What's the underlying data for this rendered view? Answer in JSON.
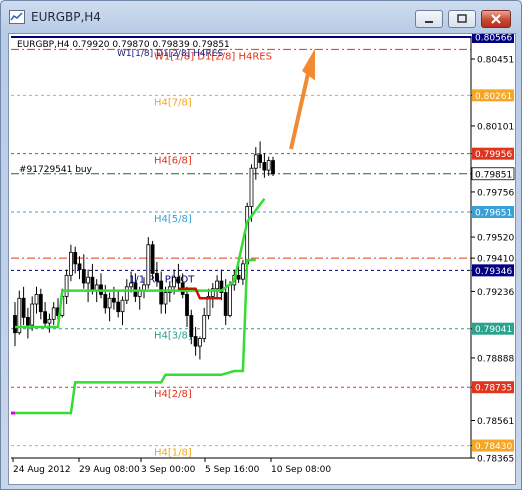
{
  "window": {
    "title": "EURGBP,H4",
    "app_icon": "chart-window-icon",
    "controls": [
      "minimize-icon",
      "maximize-icon",
      "close-icon"
    ]
  },
  "header_text": "EURGBP,H4  0.79920 0.79870 0.79839 0.79851",
  "overlap_label": "W1[1/8] D1[2/8] H4RES",
  "order_label": "#91729541 buy",
  "pivot_label": "1/1 R1 PIVOT",
  "colors": {
    "candle": "#000000",
    "trend_line": "#33dd33",
    "arrow": "#f28a33",
    "red_level": "#e0341c",
    "orange_level": "#f5a623",
    "blue_level": "#3aa0d8",
    "navy_level": "#000080",
    "green_dashdot": "#1e6e1e",
    "teal_level": "#2aa28c"
  },
  "chart_data": {
    "type": "candlestick",
    "ylim": [
      0.78365,
      0.80566
    ],
    "y_ticks": [
      "0.80566",
      "0.80451",
      "0.80261",
      "0.80101",
      "0.79956",
      "0.79851",
      "0.79756",
      "0.79651",
      "0.79520",
      "0.79410",
      "0.79346",
      "0.79236",
      "0.79041",
      "0.78888",
      "0.78735",
      "0.78561",
      "0.78430",
      "0.78365"
    ],
    "x_ticks": [
      "24 Aug 2012",
      "29 Aug 08:00",
      "3 Sep 00:00",
      "5 Sep 16:00",
      "10 Sep 08:00"
    ],
    "levels": [
      {
        "label": "",
        "value": 0.80566,
        "color": "#000080",
        "style": "solid",
        "tag": "0.80566"
      },
      {
        "label": "W1[1/8] D1[2/8] H4RES",
        "value": 0.80501,
        "color": "#e0341c",
        "style": "dashdot",
        "tag": ""
      },
      {
        "label": "H4[7/8]",
        "value": 0.80261,
        "color": "#f5a623",
        "style": "dashed",
        "tag": "0.80261"
      },
      {
        "label": "H4[6/8]",
        "value": 0.79956,
        "color": "#e0341c",
        "style": "dashed",
        "tag": "0.79956"
      },
      {
        "label": "#91729541 buy",
        "value": 0.79851,
        "color": "#1e6e1e",
        "style": "dashdot",
        "tag": "0.79851"
      },
      {
        "label": "H4[5/8]",
        "value": 0.79651,
        "color": "#3aa0d8",
        "style": "dashed",
        "tag": "0.79651"
      },
      {
        "label": "",
        "value": 0.7941,
        "color": "#e0341c",
        "style": "dashdot",
        "tag": ""
      },
      {
        "label": "",
        "value": 0.79346,
        "color": "#000080",
        "style": "dashed",
        "tag": "0.79346"
      },
      {
        "label": "H4[3/8]",
        "value": 0.79041,
        "color": "#2aa28c",
        "style": "dashed",
        "tag": "0.79041"
      },
      {
        "label": "H4[2/8]",
        "value": 0.78735,
        "color": "#e0341c",
        "style": "dashed",
        "tag": "0.78735"
      },
      {
        "label": "H4[1/8]",
        "value": 0.7843,
        "color": "#f5a623",
        "style": "dashed",
        "tag": "0.78430"
      }
    ],
    "candles": [
      [
        0.7911,
        0.7918,
        0.7895,
        0.7902
      ],
      [
        0.7902,
        0.7924,
        0.7901,
        0.792
      ],
      [
        0.792,
        0.7926,
        0.7906,
        0.791
      ],
      [
        0.791,
        0.7915,
        0.7899,
        0.7906
      ],
      [
        0.7906,
        0.7921,
        0.7903,
        0.7917
      ],
      [
        0.7917,
        0.7926,
        0.7912,
        0.7922
      ],
      [
        0.7922,
        0.7925,
        0.7909,
        0.7913
      ],
      [
        0.7913,
        0.7918,
        0.7905,
        0.7907
      ],
      [
        0.7907,
        0.7912,
        0.7902,
        0.7909
      ],
      [
        0.7909,
        0.7918,
        0.7906,
        0.7915
      ],
      [
        0.7915,
        0.792,
        0.7908,
        0.7911
      ],
      [
        0.7911,
        0.7925,
        0.791,
        0.7921
      ],
      [
        0.7921,
        0.7935,
        0.7917,
        0.7932
      ],
      [
        0.7932,
        0.7948,
        0.7929,
        0.7944
      ],
      [
        0.7944,
        0.7947,
        0.7933,
        0.7938
      ],
      [
        0.7938,
        0.7942,
        0.793,
        0.7935
      ],
      [
        0.7935,
        0.7943,
        0.7925,
        0.7928
      ],
      [
        0.7928,
        0.7935,
        0.7918,
        0.7931
      ],
      [
        0.7931,
        0.7938,
        0.7922,
        0.7924
      ],
      [
        0.7924,
        0.793,
        0.7918,
        0.7927
      ],
      [
        0.7927,
        0.7933,
        0.792,
        0.7922
      ],
      [
        0.7922,
        0.7927,
        0.7912,
        0.7915
      ],
      [
        0.7915,
        0.7923,
        0.7908,
        0.792
      ],
      [
        0.792,
        0.7926,
        0.7914,
        0.7918
      ],
      [
        0.7918,
        0.7924,
        0.791,
        0.7913
      ],
      [
        0.7913,
        0.7921,
        0.7906,
        0.7919
      ],
      [
        0.7919,
        0.793,
        0.7917,
        0.7926
      ],
      [
        0.7926,
        0.7934,
        0.7923,
        0.7928
      ],
      [
        0.7928,
        0.7933,
        0.7918,
        0.7921
      ],
      [
        0.7921,
        0.7926,
        0.7914,
        0.7924
      ],
      [
        0.7924,
        0.7931,
        0.792,
        0.7927
      ],
      [
        0.7927,
        0.7952,
        0.7925,
        0.7948
      ],
      [
        0.7948,
        0.795,
        0.793,
        0.7933
      ],
      [
        0.7933,
        0.7939,
        0.7926,
        0.7929
      ],
      [
        0.7929,
        0.7934,
        0.7912,
        0.7917
      ],
      [
        0.7917,
        0.7926,
        0.7912,
        0.7923
      ],
      [
        0.7923,
        0.7929,
        0.7918,
        0.7926
      ],
      [
        0.7926,
        0.7935,
        0.7922,
        0.7931
      ],
      [
        0.7931,
        0.7938,
        0.7924,
        0.7928
      ],
      [
        0.7928,
        0.7933,
        0.792,
        0.7922
      ],
      [
        0.7922,
        0.7926,
        0.7905,
        0.7911
      ],
      [
        0.7911,
        0.7914,
        0.7896,
        0.79
      ],
      [
        0.79,
        0.7905,
        0.789,
        0.7895
      ],
      [
        0.7895,
        0.79,
        0.7888,
        0.7899
      ],
      [
        0.7899,
        0.7915,
        0.7897,
        0.7911
      ],
      [
        0.7911,
        0.7925,
        0.7909,
        0.7921
      ],
      [
        0.7921,
        0.7928,
        0.7915,
        0.7925
      ],
      [
        0.7925,
        0.7932,
        0.792,
        0.7929
      ],
      [
        0.7929,
        0.7935,
        0.7919,
        0.7923
      ],
      [
        0.7923,
        0.793,
        0.7906,
        0.7911
      ],
      [
        0.7911,
        0.7929,
        0.791,
        0.7927
      ],
      [
        0.7927,
        0.7935,
        0.7924,
        0.7932
      ],
      [
        0.7932,
        0.7938,
        0.7928,
        0.793
      ],
      [
        0.793,
        0.794,
        0.7927,
        0.7938
      ],
      [
        0.7938,
        0.797,
        0.7935,
        0.7968
      ],
      [
        0.7968,
        0.799,
        0.796,
        0.7988
      ],
      [
        0.7988,
        0.7999,
        0.7982,
        0.7995
      ],
      [
        0.7995,
        0.8002,
        0.7988,
        0.7991
      ],
      [
        0.7991,
        0.7996,
        0.7983,
        0.7987
      ],
      [
        0.7987,
        0.7994,
        0.7984,
        0.7992
      ],
      [
        0.7992,
        0.7994,
        0.79839,
        0.79851
      ]
    ],
    "trend_line": [
      [
        0,
        0.786
      ],
      [
        13,
        0.786
      ],
      [
        14,
        0.7876
      ],
      [
        34,
        0.7876
      ],
      [
        35,
        0.788
      ],
      [
        48,
        0.788
      ],
      [
        51,
        0.7882
      ],
      [
        53,
        0.7882
      ],
      [
        54,
        0.794
      ],
      [
        56,
        0.794
      ],
      [
        0,
        0.7905
      ],
      [
        10,
        0.7905
      ],
      [
        11,
        0.7924
      ],
      [
        48,
        0.7924
      ],
      [
        51,
        0.7929
      ],
      [
        54,
        0.796
      ],
      [
        58,
        0.7972
      ]
    ],
    "red_segment": [
      [
        38,
        0.7925
      ],
      [
        42,
        0.7925
      ],
      [
        43,
        0.792
      ],
      [
        48,
        0.792
      ]
    ]
  }
}
